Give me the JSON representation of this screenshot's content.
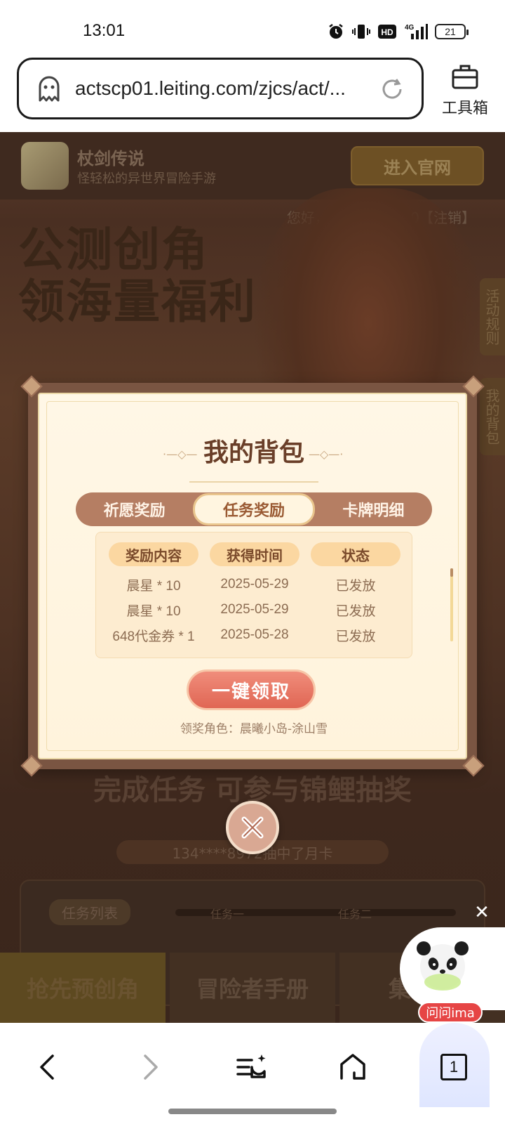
{
  "status_bar": {
    "time": "13:01",
    "icons": [
      "alarm-icon",
      "vibrate-icon",
      "hd-icon",
      "4g-signal-icon"
    ],
    "hd_label": "HD",
    "network_label": "4G",
    "battery": "21"
  },
  "browser": {
    "url": "actscp01.leiting.com/zjcs/act/...",
    "toolbox_label": "工具箱"
  },
  "page": {
    "game_name": "杖剑传说",
    "game_subtitle": "怪轻松的异世界冒险手游",
    "enter_site": "进入官网",
    "greeting": "您好，175****2130【注销】",
    "hero_line1": "公测创角",
    "hero_line2": "领海量福利",
    "side_tab_rules": "活动规则",
    "side_tab_bag": "我的背包",
    "banner_title": "完成任务 可参与锦鲤抽奖",
    "ticker_text": "134****8972抽中了月卡",
    "task_list_label": "任务列表",
    "task_one": "任务一",
    "task_two": "任务二",
    "bottom_tabs": [
      "抢先预创角",
      "冒险者手册",
      "集元券"
    ]
  },
  "modal": {
    "title": "我的背包",
    "tabs": [
      {
        "label": "祈愿奖励",
        "active": false
      },
      {
        "label": "任务奖励",
        "active": true
      },
      {
        "label": "卡牌明细",
        "active": false
      }
    ],
    "columns": [
      "奖励内容",
      "获得时间",
      "状态"
    ],
    "rows": [
      [
        "晨星 * 10",
        "2025-05-29",
        "已发放"
      ],
      [
        "晨星 * 10",
        "2025-05-29",
        "已发放"
      ],
      [
        "648代金券 * 1",
        "2025-05-28",
        "已发放"
      ]
    ],
    "claim_button": "一键领取",
    "claim_role": "领奖角色：晨曦小岛-涂山雪"
  },
  "assistant": {
    "label": "问问ima",
    "close": "✕"
  },
  "nav": {
    "tab_count": "1"
  },
  "colors": {
    "modal_border": "#7a5542",
    "modal_bg": "#fff7e6",
    "tab_bar": "#b57e63",
    "claim_button": "#e06654",
    "ima_label": "#e64545"
  }
}
